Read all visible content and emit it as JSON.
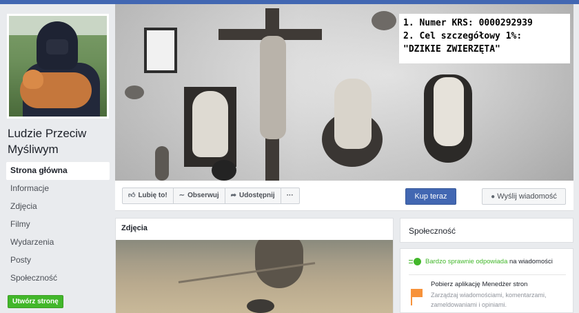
{
  "page": {
    "name": "Ludzie Przeciw Myśliwym"
  },
  "sidebar": {
    "items": [
      {
        "label": "Strona główna",
        "active": true
      },
      {
        "label": "Informacje"
      },
      {
        "label": "Zdjęcia"
      },
      {
        "label": "Filmy"
      },
      {
        "label": "Wydarzenia"
      },
      {
        "label": "Posty"
      },
      {
        "label": "Społeczność"
      }
    ],
    "create_button": "Utwórz stronę"
  },
  "cover": {
    "krs_line1": "1. Numer KRS: 0000292939",
    "krs_line2": "2. Cel szczegółowy 1%:",
    "krs_line3": "\"DZIKIE ZWIERZĘTA\""
  },
  "actions": {
    "like": "Lubię to!",
    "follow": "Obserwuj",
    "share": "Udostępnij",
    "more": "···",
    "buy": "Kup teraz",
    "message": "Wyślij wiadomość"
  },
  "photos": {
    "title": "Zdjęcia"
  },
  "community": {
    "title": "Społeczność",
    "response_highlight": "Bardzo sprawnie odpowiada",
    "response_rest": " na wiadomości",
    "manager_title": "Pobierz aplikację Menedżer stron",
    "manager_desc": "Zarządzaj wiadomościami, komentarzami, zameldowaniami i opiniami."
  },
  "colors": {
    "brand_blue": "#4267b2",
    "green": "#42b72a",
    "orange": "#f7923a",
    "background": "#e9ebee"
  },
  "icons": {
    "like": "thumbs-up-icon",
    "follow": "rss-icon",
    "share": "share-arrow-icon",
    "message": "messenger-icon",
    "response": "fast-response-icon",
    "manager": "flag-icon"
  }
}
